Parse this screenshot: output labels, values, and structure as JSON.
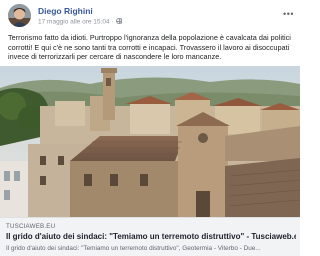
{
  "post": {
    "author": "Diego Righini",
    "timestamp": "17 maggio alle ore 15:04 ·",
    "privacy_icon": "globe-icon",
    "menu_icon": "more-options-icon",
    "text": "Terrorismo fatto da idioti. Purtroppo l'ignoranza della popolazione è cavalcata dai politici corrotti! E qui c'è ne sono tanti tra corrotti e incapaci. Trovassero il lavoro ai disoccupati invece di terrorizzarli per cercare di nascondere le loro mancanze."
  },
  "link_preview": {
    "domain": "TUSCIAWEB.EU",
    "title": "Il grido d'aiuto dei sindaci: \"Temiamo un terremoto distruttivo\" - Tusciaweb.eu",
    "description": "Il grido d'aiuto dei sindaci: \"Temiamo un terremoto distruttivo\", Geotermia - Viterbo - Due..."
  },
  "colors": {
    "author_link": "#385898",
    "meta_gray": "#90949c",
    "link_bg": "#f2f3f5"
  }
}
